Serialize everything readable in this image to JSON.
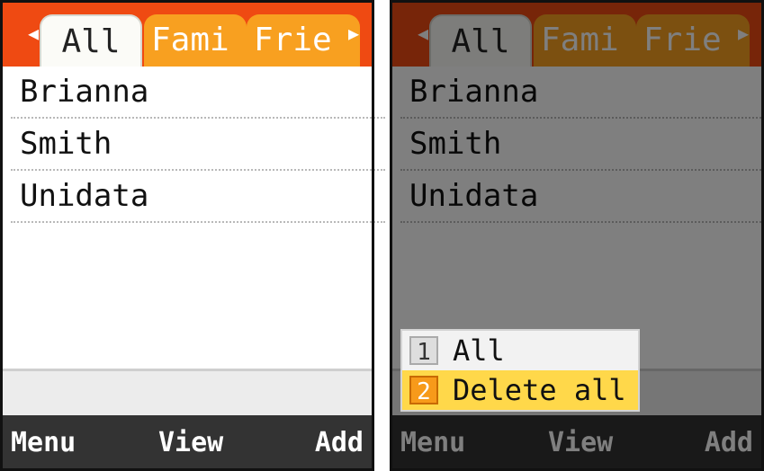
{
  "screens": [
    {
      "tabs": [
        "All",
        "Fami",
        "Frie"
      ],
      "contacts": [
        "Brianna",
        "Smith",
        "Unidata"
      ],
      "softkeys": {
        "left": "Menu",
        "center": "View",
        "right": "Add"
      }
    },
    {
      "tabs": [
        "All",
        "Fami",
        "Frie"
      ],
      "contacts": [
        "Brianna",
        "Smith",
        "Unidata"
      ],
      "softkeys": {
        "left": "Menu",
        "center": "View",
        "right": "Add"
      },
      "popup": {
        "items": [
          {
            "num": "1",
            "label": "All"
          },
          {
            "num": "2",
            "label": "Delete all"
          }
        ],
        "selected_index": 1
      }
    }
  ],
  "colors": {
    "tabbar": "#ef4a12",
    "tab_inactive": "#f8a020",
    "softkey_bar": "#333333",
    "popup_selected": "#ffd84a"
  },
  "icons": {
    "left": "left-arrow-icon",
    "right": "right-arrow-icon"
  }
}
